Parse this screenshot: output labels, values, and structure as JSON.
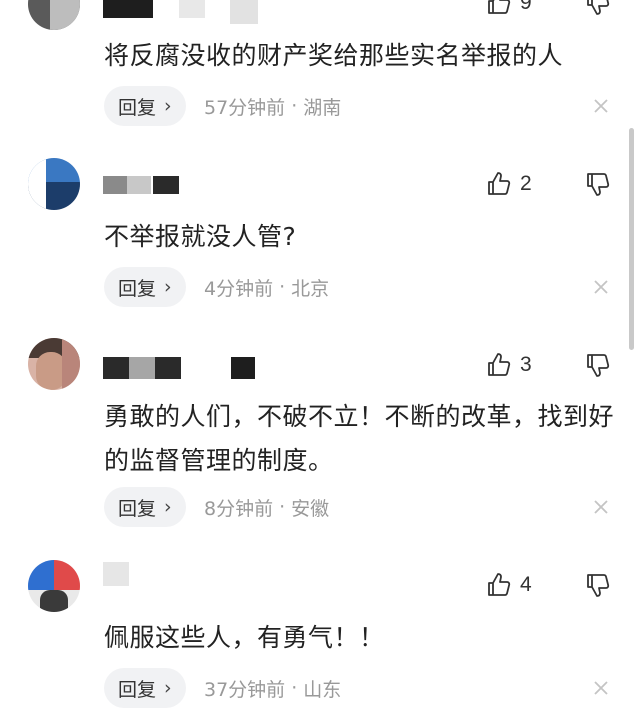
{
  "comments": [
    {
      "text": "将反腐没收的财产奖给那些实名举报的人",
      "like_count": "9",
      "reply_label": "回复",
      "time": "57分钟前",
      "location": "湖南",
      "separator": "·"
    },
    {
      "text": "不举报就没人管?",
      "like_count": "2",
      "reply_label": "回复",
      "time": "4分钟前",
      "location": "北京",
      "separator": "·"
    },
    {
      "text": "勇敢的人们，不破不立！不断的改革，找到好的监督管理的制度。",
      "like_count": "3",
      "reply_label": "回复",
      "time": "8分钟前",
      "location": "安徽",
      "separator": "·"
    },
    {
      "text": "佩服这些人，有勇气！！",
      "like_count": "4",
      "reply_label": "回复",
      "time": "37分钟前",
      "location": "山东",
      "separator": "·"
    }
  ],
  "icons": {
    "reply_chevron": "›",
    "like": "thumbs-up-icon",
    "dislike": "thumbs-down-icon",
    "close": "close-icon"
  },
  "colors": {
    "text": "#222222",
    "meta": "#999999",
    "pill_bg": "#f1f2f4"
  }
}
